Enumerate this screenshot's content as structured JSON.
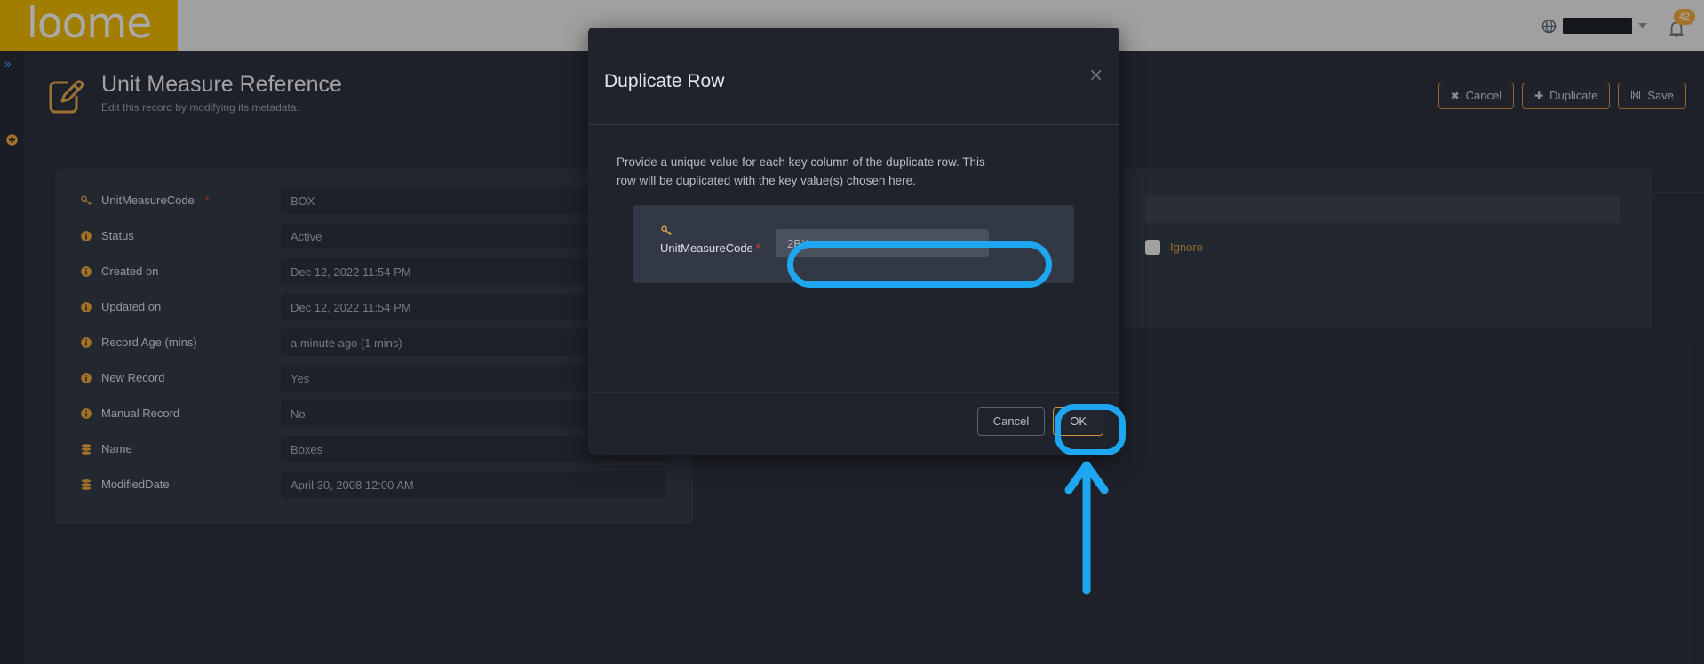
{
  "topbar": {
    "logo_text": "loome",
    "globe_icon": "globe-icon",
    "region_value": "",
    "caret_icon": "chevron-down-icon",
    "bell_icon": "bell-icon",
    "notification_count": "42"
  },
  "rail": {
    "expand_icon": "»",
    "add_icon": "plus-circle-icon"
  },
  "page": {
    "icon": "edit-record-icon",
    "title": "Unit Measure Reference",
    "subtitle": "Edit this record by modifying its metadata.",
    "actions": [
      {
        "label": "Cancel",
        "icon": "✖",
        "name": "cancel-button"
      },
      {
        "label": "Duplicate",
        "icon": "✚",
        "name": "duplicate-button"
      },
      {
        "label": "Save",
        "icon": "ὋE",
        "name": "save-button"
      }
    ]
  },
  "form": {
    "fields": [
      {
        "label": "UnitMeasureCode",
        "required": true,
        "icon": "key-icon",
        "value": "BOX"
      },
      {
        "label": "Status",
        "required": false,
        "icon": "info-icon",
        "value": "Active"
      },
      {
        "label": "Created on",
        "required": false,
        "icon": "info-icon",
        "value": "Dec 12, 2022 11:54 PM"
      },
      {
        "label": "Updated on",
        "required": false,
        "icon": "info-icon",
        "value": "Dec 12, 2022 11:54 PM"
      },
      {
        "label": "Record Age (mins)",
        "required": false,
        "icon": "info-icon",
        "value": "a minute ago (1 mins)"
      },
      {
        "label": "New Record",
        "required": false,
        "icon": "info-icon",
        "value": "Yes"
      },
      {
        "label": "Manual Record",
        "required": false,
        "icon": "info-icon",
        "value": "No"
      },
      {
        "label": "Name",
        "required": false,
        "icon": "database-icon",
        "value": "Boxes"
      },
      {
        "label": "ModifiedDate",
        "required": false,
        "icon": "database-icon",
        "value": "April 30, 2008 12:00 AM"
      }
    ]
  },
  "right_panel": {
    "input_value": "",
    "ignore_label": "Ignore",
    "ignore_checked": false
  },
  "modal": {
    "title": "Duplicate Row",
    "close_icon": "×",
    "description": "Provide a unique value for each key column of the duplicate row. This row will be duplicated with the key value(s) chosen here.",
    "key_field": {
      "icon": "key-icon",
      "label": "UnitMeasureCode",
      "required_marker": "*",
      "value": "2BX",
      "placeholder": "2BX"
    },
    "cancel_label": "Cancel",
    "ok_label": "OK"
  },
  "colors": {
    "brand_yellow": "#e8b500",
    "accent_orange": "#d58e3a",
    "highlight_blue": "#1ea7f0",
    "required_red": "#e2403a",
    "page_bg": "#2b303b",
    "panel_bg": "#323846",
    "modal_bg": "#1f232b"
  }
}
